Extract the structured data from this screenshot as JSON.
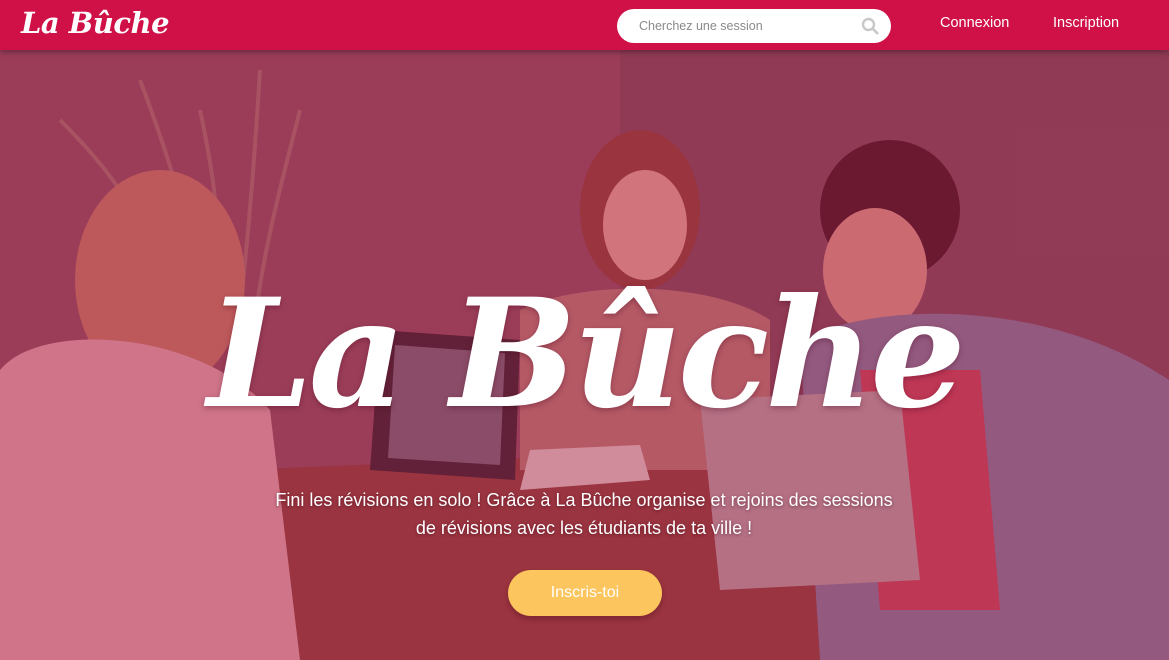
{
  "nav": {
    "brand": "La Bûche",
    "search_placeholder": "Cherchez une session",
    "login": "Connexion",
    "signup": "Inscription"
  },
  "hero": {
    "title": "La Bûche",
    "subtitle": "Fini les révisions en solo ! Grâce à La Bûche organise et rejoins des sessions de révisions avec les étudiants de ta ville !",
    "cta": "Inscris-toi"
  },
  "colors": {
    "navbar": "#cf1148",
    "overlay": "#b01648",
    "cta": "#fdc55d",
    "text": "#ffffff"
  },
  "icons": {
    "search": "search-icon"
  }
}
